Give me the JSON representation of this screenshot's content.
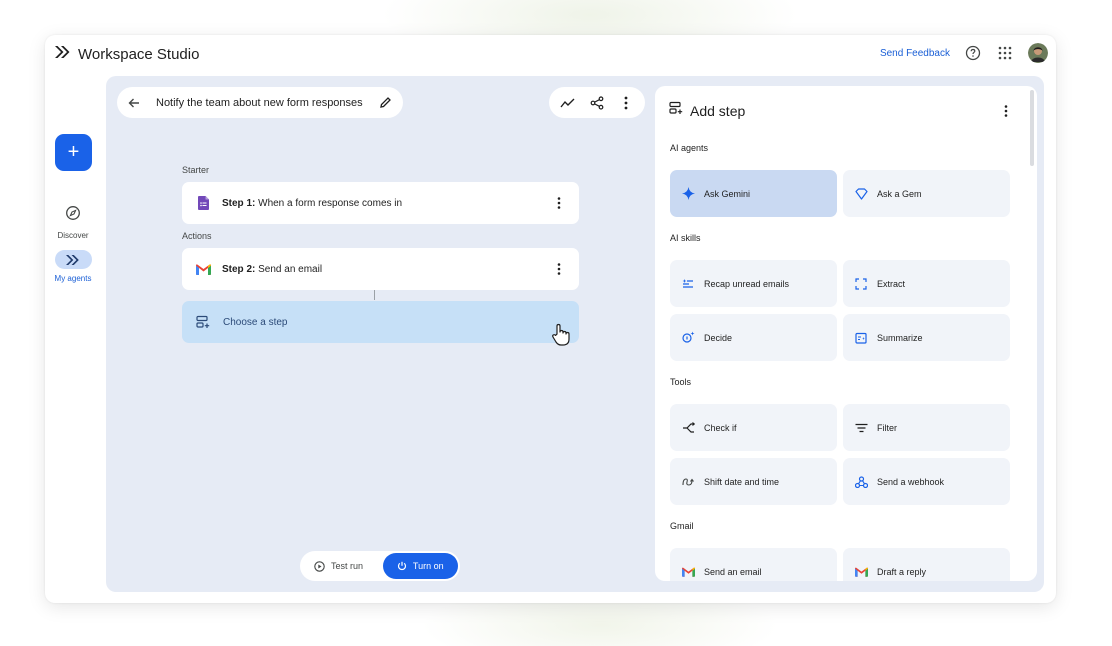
{
  "app": {
    "title": "Workspace Studio",
    "feedback_label": "Send Feedback"
  },
  "rail": {
    "create_label": "+",
    "items": [
      {
        "label": "Discover",
        "icon": "compass-icon"
      },
      {
        "label": "My agents",
        "icon": "agents-icon"
      }
    ]
  },
  "agent": {
    "title": "Notify the team about new form responses"
  },
  "flow": {
    "starter_label": "Starter",
    "actions_label": "Actions",
    "steps": [
      {
        "prefix": "Step 1:",
        "text": "When a form response comes in",
        "icon": "google-forms-icon"
      },
      {
        "prefix": "Step 2:",
        "text": "Send an email",
        "icon": "gmail-icon"
      }
    ],
    "choose_label": "Choose a step"
  },
  "run": {
    "test_label": "Test run",
    "turn_on_label": "Turn on"
  },
  "panel": {
    "title": "Add step",
    "categories": [
      {
        "label": "AI agents",
        "options": [
          {
            "label": "Ask Gemini",
            "icon": "gemini-sparkle-icon",
            "selected": true
          },
          {
            "label": "Ask a Gem",
            "icon": "gem-icon"
          }
        ]
      },
      {
        "label": "AI skills",
        "options": [
          {
            "label": "Recap unread emails",
            "icon": "recap-icon"
          },
          {
            "label": "Extract",
            "icon": "extract-icon"
          },
          {
            "label": "Decide",
            "icon": "decide-icon"
          },
          {
            "label": "Summarize",
            "icon": "summarize-icon"
          }
        ]
      },
      {
        "label": "Tools",
        "options": [
          {
            "label": "Check if",
            "icon": "branch-icon"
          },
          {
            "label": "Filter",
            "icon": "filter-icon"
          },
          {
            "label": "Shift date and time",
            "icon": "shift-date-icon"
          },
          {
            "label": "Send a webhook",
            "icon": "webhook-icon"
          }
        ]
      },
      {
        "label": "Gmail",
        "options": [
          {
            "label": "Send an email",
            "icon": "gmail-icon"
          },
          {
            "label": "Draft a reply",
            "icon": "gmail-icon"
          }
        ]
      }
    ]
  },
  "colors": {
    "accent": "#1a62e8",
    "canvas": "#e6ebf5",
    "selected": "#c9d9f2",
    "choose": "#c6e0f7"
  }
}
